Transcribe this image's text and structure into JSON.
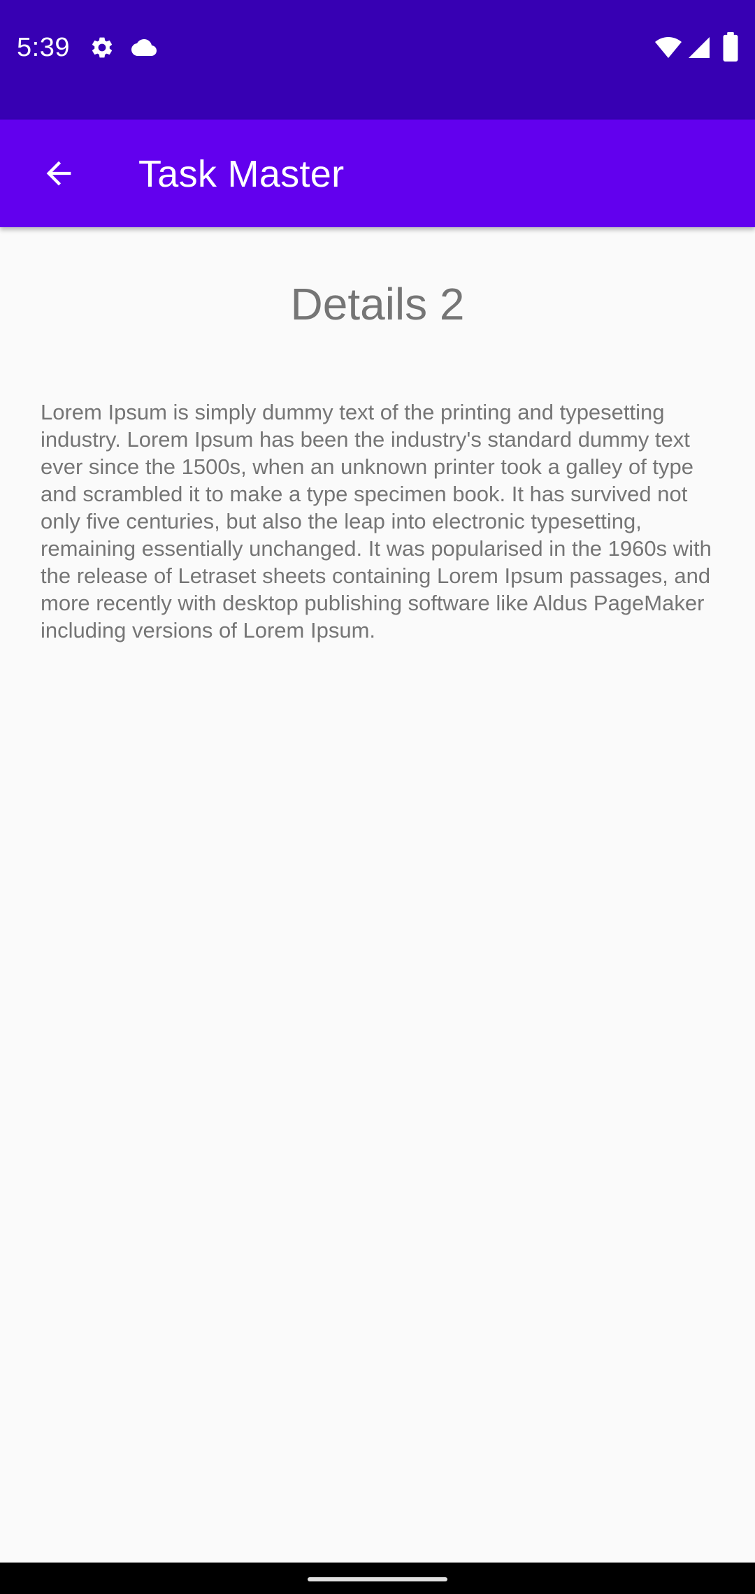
{
  "status_bar": {
    "time": "5:39",
    "icons": [
      "settings-icon",
      "cloud-icon",
      "wifi-icon",
      "signal-icon",
      "battery-icon"
    ]
  },
  "app_bar": {
    "title": "Task Master",
    "back_icon": "arrow-back-icon"
  },
  "details": {
    "title": "Details 2",
    "body": "Lorem Ipsum is simply dummy text of the printing and typesetting industry. Lorem Ipsum has been the industry's standard dummy text ever since the 1500s, when an unknown printer took a galley of type and scrambled it to make a type specimen book. It has survived not only five centuries, but also the leap into electronic typesetting, remaining essentially unchanged. It was popularised in the 1960s with the release of Letraset sheets containing Lorem Ipsum passages, and more recently with desktop publishing software like Aldus PageMaker including versions of Lorem Ipsum."
  },
  "colors": {
    "status_bar": "#3700b3",
    "app_bar": "#6200ee",
    "background": "#fafafa",
    "text_secondary": "#757575"
  }
}
